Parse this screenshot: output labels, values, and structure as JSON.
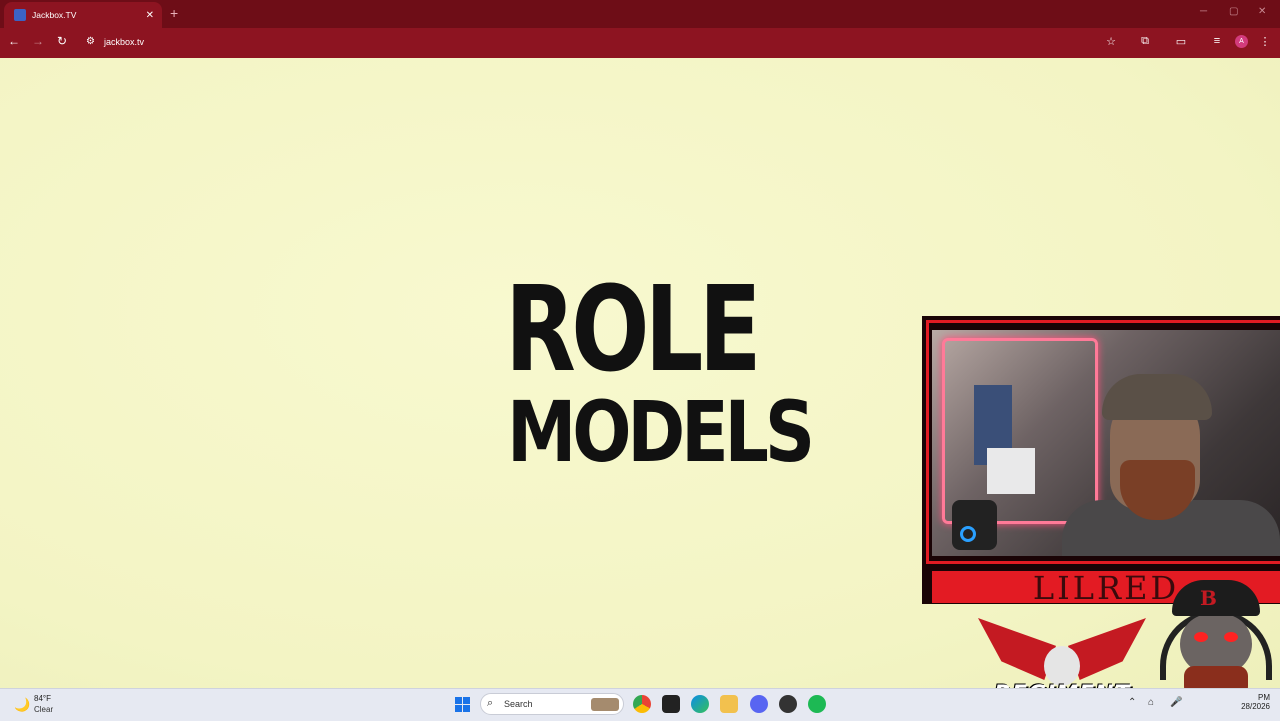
{
  "browser": {
    "tab_title": "Jackbox.TV",
    "tab_close": "✕",
    "new_tab": "+",
    "url": "jackbox.tv",
    "profile_initial": "A",
    "accent": "#8d1421"
  },
  "page": {
    "logo_line1": "ROLE",
    "logo_line2": "MODELS",
    "background": "#f5f6c8"
  },
  "stream_overlay": {
    "streamer_name": "LILRED",
    "team_logo_text": "REGIMENT",
    "accent": "#e31b23"
  },
  "taskbar": {
    "weather_temp": "84°F",
    "weather_condition": "Clear",
    "search_label": "Search",
    "clock_time": "PM",
    "clock_date": "28/2026"
  }
}
